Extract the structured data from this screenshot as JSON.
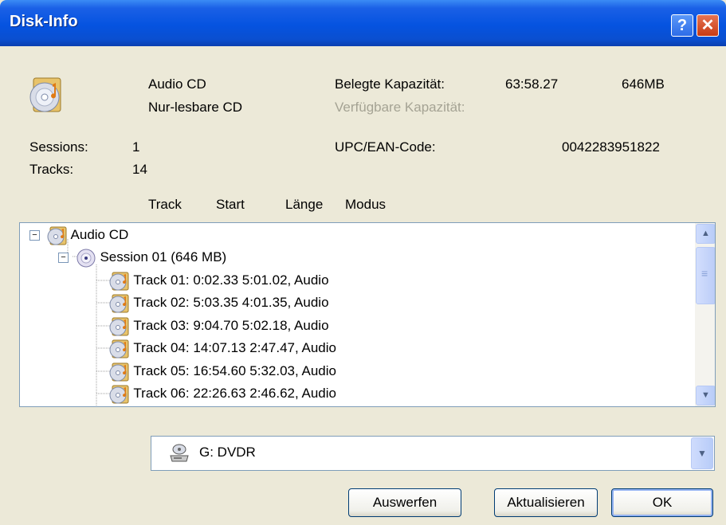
{
  "window": {
    "title": "Disk-Info",
    "help_glyph": "?",
    "close_glyph": "✕"
  },
  "info": {
    "disc_type": "Audio CD",
    "disc_mode": "Nur-lesbare CD",
    "used_label": "Belegte Kapazität:",
    "used_time": "63:58.27",
    "used_size": "646MB",
    "free_label": "Verfügbare Kapazität:",
    "sessions_label": "Sessions:",
    "sessions_value": "1",
    "tracks_label": "Tracks:",
    "tracks_value": "14",
    "upc_label": "UPC/EAN-Code:",
    "upc_value": "0042283951822"
  },
  "columns": {
    "track": "Track",
    "start": "Start",
    "length": "Länge",
    "mode": "Modus"
  },
  "tree": {
    "root_label": "Audio CD",
    "session_label": "Session 01 (646 MB)",
    "collapse_glyph": "−",
    "tracks": [
      "Track 01: 0:02.33 5:01.02, Audio",
      "Track 02: 5:03.35 4:01.35, Audio",
      "Track 03: 9:04.70 5:02.18, Audio",
      "Track 04: 14:07.13 2:47.47, Audio",
      "Track 05: 16:54.60 5:32.03, Audio",
      "Track 06: 22:26.63 2:46.62, Audio"
    ]
  },
  "scrollbar": {
    "up_glyph": "▲",
    "down_glyph": "▼",
    "grip_glyph": "≡"
  },
  "drive": {
    "value": "G: DVDR",
    "dropdown_glyph": "▼"
  },
  "buttons": {
    "eject": "Auswerfen",
    "refresh": "Aktualisieren",
    "ok": "OK"
  },
  "icons": {
    "disc": "audio-cd-icon",
    "session": "session-disc-icon",
    "drive": "drive-icon"
  },
  "colors": {
    "titlebar": "#0553e0",
    "dialog_bg": "#ece9d8",
    "disabled_text": "#a5a394",
    "close_button": "#c83b14"
  }
}
